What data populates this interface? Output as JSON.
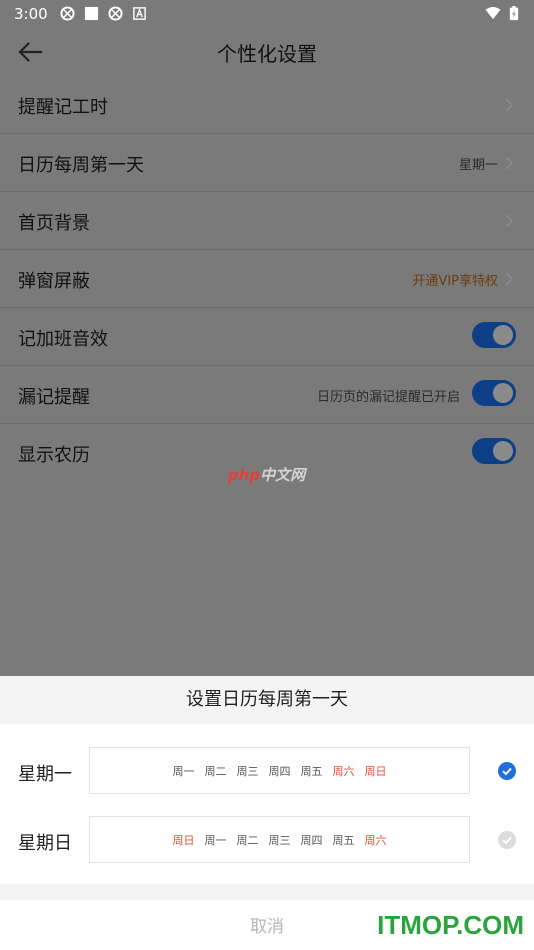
{
  "status_bar": {
    "time": "3:00"
  },
  "header": {
    "title": "个性化设置"
  },
  "settings": [
    {
      "label": "提醒记工时",
      "value": ""
    },
    {
      "label": "日历每周第一天",
      "value": "星期一"
    },
    {
      "label": "首页背景",
      "value": ""
    },
    {
      "label": "弹窗屏蔽",
      "value": "开通VIP享特权"
    },
    {
      "label": "记加班音效",
      "value": ""
    },
    {
      "label": "漏记提醒",
      "value": "日历页的漏记提醒已开启"
    },
    {
      "label": "显示农历",
      "value": ""
    }
  ],
  "watermark": {
    "php": "php",
    "cn": "中文网"
  },
  "sheet": {
    "title": "设置日历每周第一天",
    "options": [
      {
        "label": "星期一",
        "days": [
          "周一",
          "周二",
          "周三",
          "周四",
          "周五",
          "周六",
          "周日"
        ],
        "selected": true
      },
      {
        "label": "星期日",
        "days": [
          "周日",
          "周一",
          "周二",
          "周三",
          "周四",
          "周五",
          "周六"
        ],
        "selected": false
      }
    ],
    "cancel": "取消"
  },
  "brand_watermark": "ITMOP.COM",
  "colors": {
    "accent": "#0c3f85",
    "check_blue": "#1e6fd9",
    "weekend": "#e0503a",
    "itmop_green": "#2aa53d"
  }
}
